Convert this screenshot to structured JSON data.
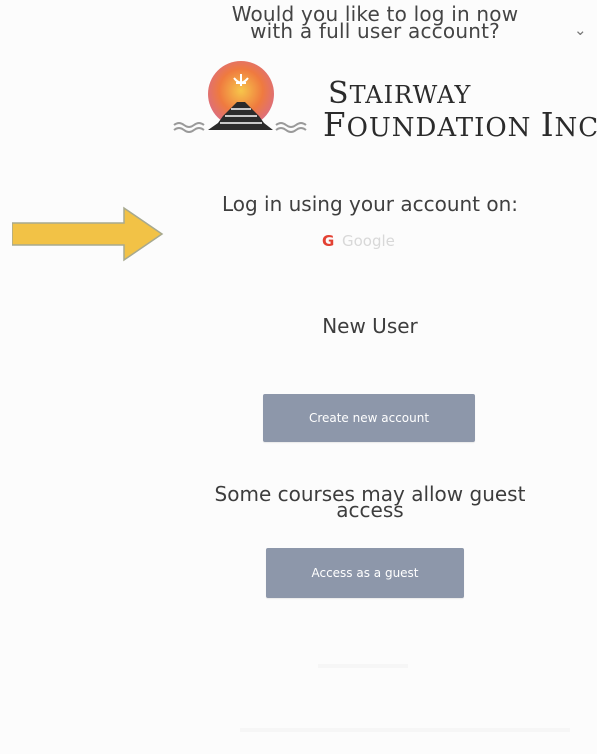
{
  "prompt": {
    "line1": "Would you like to log in now",
    "line2": "with a full user account?"
  },
  "logo": {
    "line1_cap": "S",
    "line1_rest": "TAIRWAY",
    "line2_cap": "F",
    "line2_rest": "OUNDATION ",
    "line2_cap2": "I",
    "line2_rest2": "NC."
  },
  "login": {
    "heading": "Log in using your account on:",
    "google_label": "Google"
  },
  "new_user": {
    "heading": "New User",
    "create_button": "Create new account"
  },
  "guest": {
    "line1": "Some courses may allow guest",
    "line2": "access",
    "button": "Access as a guest"
  },
  "colors": {
    "button": "#8d97aa",
    "arrow": "#f2c246",
    "sun_orange": "#ef7a3f",
    "sun_pink": "#d86b8d",
    "pyramid": "#2b2b2b"
  },
  "icons": {
    "chevron": "chevron-down-icon",
    "arrow": "arrow-right-icon",
    "google": "google-icon"
  }
}
